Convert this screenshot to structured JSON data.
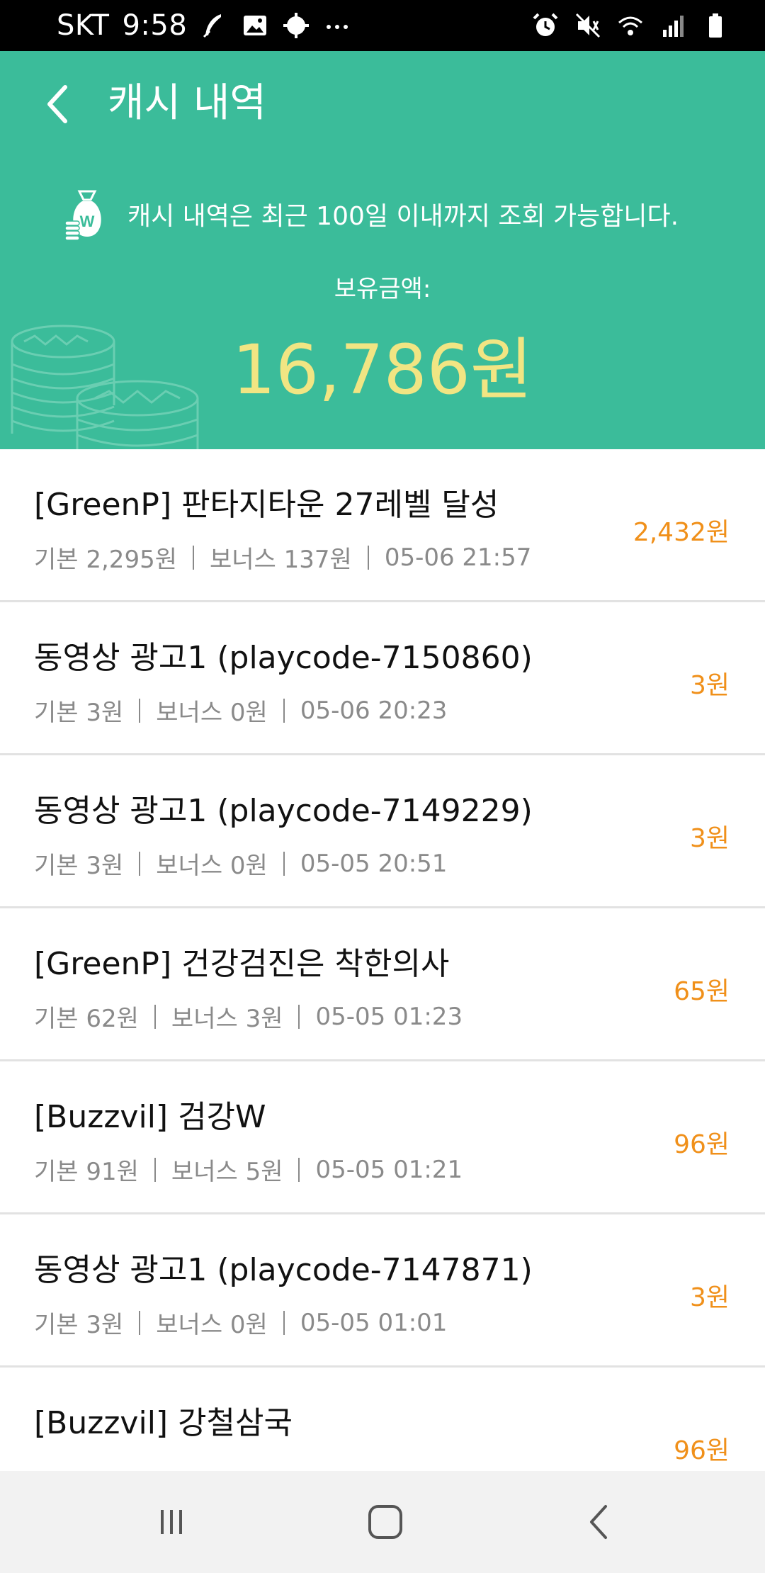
{
  "status_bar": {
    "carrier": "SKT",
    "time": "9:58",
    "icons_left": [
      "feather-icon",
      "image-icon",
      "gear-icon",
      "more-dots-icon"
    ],
    "icons_right": [
      "alarm-icon",
      "mute-icon",
      "wifi-icon",
      "signal-icon",
      "battery-icon"
    ]
  },
  "header": {
    "title": "캐시 내역",
    "notice": "캐시 내역은 최근 100일 이내까지 조회 가능합니다.",
    "balance_label": "보유금액:",
    "balance_amount": "16,786원",
    "bg_color": "#3bbc9a",
    "amount_color": "#f1e583"
  },
  "list": {
    "amount_color": "#f0901a",
    "items": [
      {
        "title": "[GreenP] 판타지타운 27레벨 달성",
        "base": "기본 2,295원",
        "bonus": "보너스 137원",
        "datetime": "05-06 21:57",
        "amount": "2,432원"
      },
      {
        "title": "동영상 광고1 (playcode-7150860)",
        "base": "기본 3원",
        "bonus": "보너스 0원",
        "datetime": "05-06 20:23",
        "amount": "3원"
      },
      {
        "title": "동영상 광고1 (playcode-7149229)",
        "base": "기본 3원",
        "bonus": "보너스 0원",
        "datetime": "05-05 20:51",
        "amount": "3원"
      },
      {
        "title": "[GreenP] 건강검진은 착한의사",
        "base": "기본 62원",
        "bonus": "보너스 3원",
        "datetime": "05-05 01:23",
        "amount": "65원"
      },
      {
        "title": "[Buzzvil] 검강W",
        "base": "기본 91원",
        "bonus": "보너스 5원",
        "datetime": "05-05 01:21",
        "amount": "96원"
      },
      {
        "title": "동영상 광고1 (playcode-7147871)",
        "base": "기본 3원",
        "bonus": "보너스 0원",
        "datetime": "05-05 01:01",
        "amount": "3원"
      },
      {
        "title": "[Buzzvil] 강철삼국",
        "base": "",
        "bonus": "",
        "datetime": "",
        "amount": "96원"
      }
    ]
  },
  "nav_bar": {
    "buttons": [
      "recent-apps-icon",
      "home-icon",
      "back-icon"
    ]
  }
}
